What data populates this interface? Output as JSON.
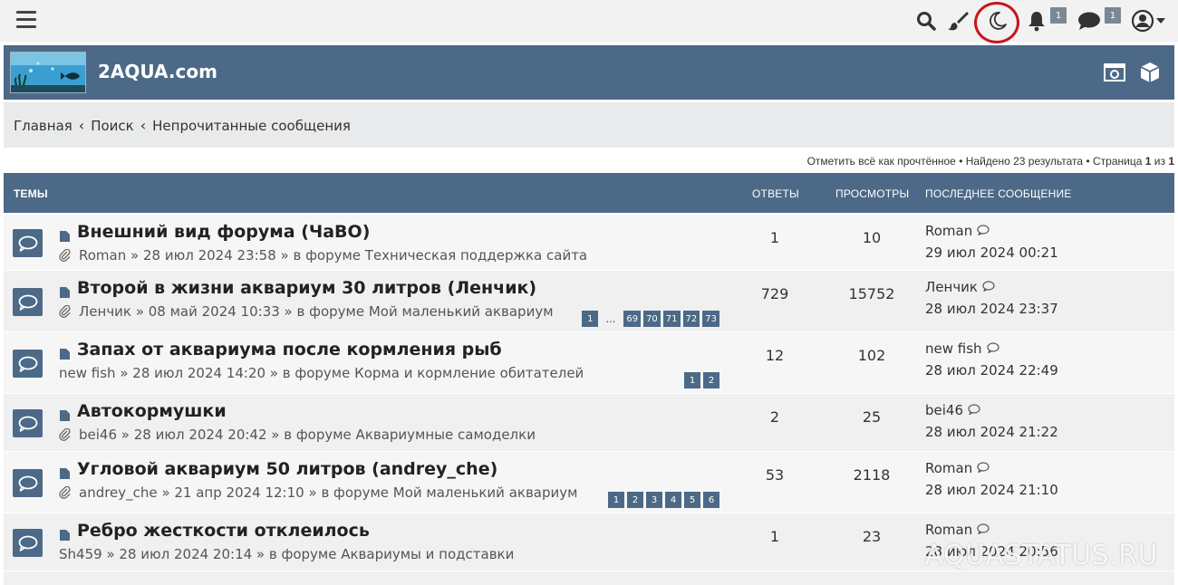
{
  "site": {
    "title": "2AQUA.com"
  },
  "breadcrumb": [
    "Главная",
    "Поиск",
    "Непрочитанные сообщения"
  ],
  "breadcrumb_sep": "‹",
  "top_badges": {
    "notifications": "1",
    "messages": "1"
  },
  "action_bar": {
    "mark_read": "Отметить всё как прочтённое",
    "found": "Найдено 23 результата",
    "page_prefix": "Страница",
    "page_current": "1",
    "page_of": "из",
    "page_total": "1",
    "bullet": "•"
  },
  "table_head": {
    "topics": "ТЕМЫ",
    "replies": "ОТВЕТЫ",
    "views": "ПРОСМОТРЫ",
    "last_post": "ПОСЛЕДНЕЕ СООБЩЕНИЕ"
  },
  "rows": [
    {
      "title": "Внешний вид форума (ЧаВО)",
      "author": "Roman",
      "date": "» 28 июл 2024 23:58 »",
      "forum": "в форуме Техническая поддержка сайта",
      "replies": "1",
      "views": "10",
      "last_user": "Roman",
      "last_date": "29 июл 2024 00:21",
      "pages": []
    },
    {
      "title": "Второй в жизни аквариум 30 литров (Ленчик)",
      "author": "Ленчик",
      "date": "» 08 май 2024 10:33 »",
      "forum": "в форуме Мой маленький аквариум",
      "replies": "729",
      "views": "15752",
      "last_user": "Ленчик",
      "last_date": "28 июл 2024 23:37",
      "pages": [
        "1",
        "…",
        "69",
        "70",
        "71",
        "72",
        "73"
      ]
    },
    {
      "title": "Запах от аквариума после кормления рыб",
      "author": "new fish",
      "date": "» 28 июл 2024 14:20 »",
      "forum": "в форуме Корма и кормление обитателей",
      "replies": "12",
      "views": "102",
      "last_user": "new fish",
      "last_date": "28 июл 2024 22:49",
      "pages": [
        "1",
        "2"
      ]
    },
    {
      "title": "Автокормушки",
      "author": "bei46",
      "date": "» 28 июл 2024 20:42 »",
      "forum": "в форуме Аквариумные самоделки",
      "replies": "2",
      "views": "25",
      "last_user": "bei46",
      "last_date": "28 июл 2024 21:22",
      "pages": []
    },
    {
      "title": "Угловой аквариум 50 литров (andrey_che)",
      "author": "andrey_che",
      "date": "» 21 апр 2024 12:10 »",
      "forum": "в форуме Мой маленький аквариум",
      "replies": "53",
      "views": "2118",
      "last_user": "Roman",
      "last_date": "28 июл 2024 21:10",
      "pages": [
        "1",
        "2",
        "3",
        "4",
        "5",
        "6"
      ]
    },
    {
      "title": "Ребро жесткости отклеилось",
      "author": "Sh459",
      "date": "» 28 июл 2024 20:14 »",
      "forum": "в форуме Аквариумы и подставки",
      "replies": "1",
      "views": "23",
      "last_user": "Roman",
      "last_date": "28 июл 2024 20:56",
      "pages": []
    }
  ],
  "watermark": "AQUASTATUS.RU",
  "colors": {
    "header": "#4c6a87",
    "accent_ring": "#c8161d",
    "badge": "#7a8794"
  }
}
